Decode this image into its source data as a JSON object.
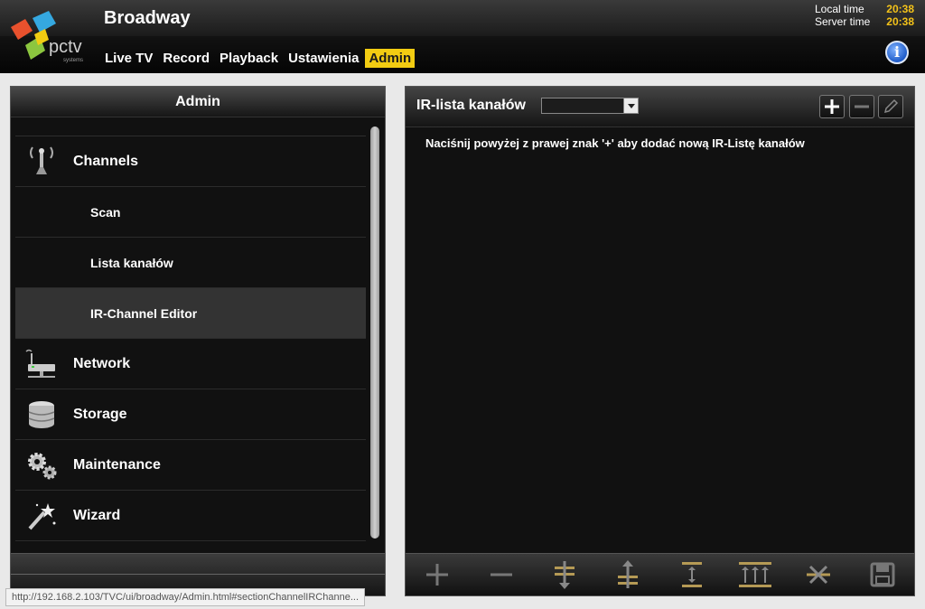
{
  "header": {
    "brand": "Broadway",
    "logo_text": "pctv",
    "logo_sub": "systems",
    "local_time_label": "Local time",
    "local_time": "20:38",
    "server_time_label": "Server time",
    "server_time": "20:38",
    "info_glyph": "i"
  },
  "nav": [
    "Live TV",
    "Record",
    "Playback",
    "Ustawienia",
    "Admin"
  ],
  "nav_active": "Admin",
  "left": {
    "title": "Admin",
    "items": [
      {
        "label": "Channels",
        "icon": "antenna-icon",
        "type": "main"
      },
      {
        "label": "Scan",
        "type": "sub"
      },
      {
        "label": "Lista kanałów",
        "type": "sub"
      },
      {
        "label": "IR-Channel Editor",
        "type": "sub",
        "active": true
      },
      {
        "label": "Network",
        "icon": "network-icon",
        "type": "main"
      },
      {
        "label": "Storage",
        "icon": "storage-icon",
        "type": "main"
      },
      {
        "label": "Maintenance",
        "icon": "gears-icon",
        "type": "main"
      },
      {
        "label": "Wizard",
        "icon": "magic-wand-icon",
        "type": "main"
      }
    ]
  },
  "status_url": "http://192.168.2.103/TVC/ui/broadway/Admin.html#sectionChannelIRChanne...",
  "right": {
    "title": "IR-lista kanałów",
    "select_value": "",
    "hint": "Naciśnij powyżej z prawej znak '+' aby dodać nową IR-Listę kanałów"
  },
  "colors": {
    "accent": "#f2cc12",
    "time": "#f3c219",
    "toolbar_icon": "#b59a55"
  }
}
